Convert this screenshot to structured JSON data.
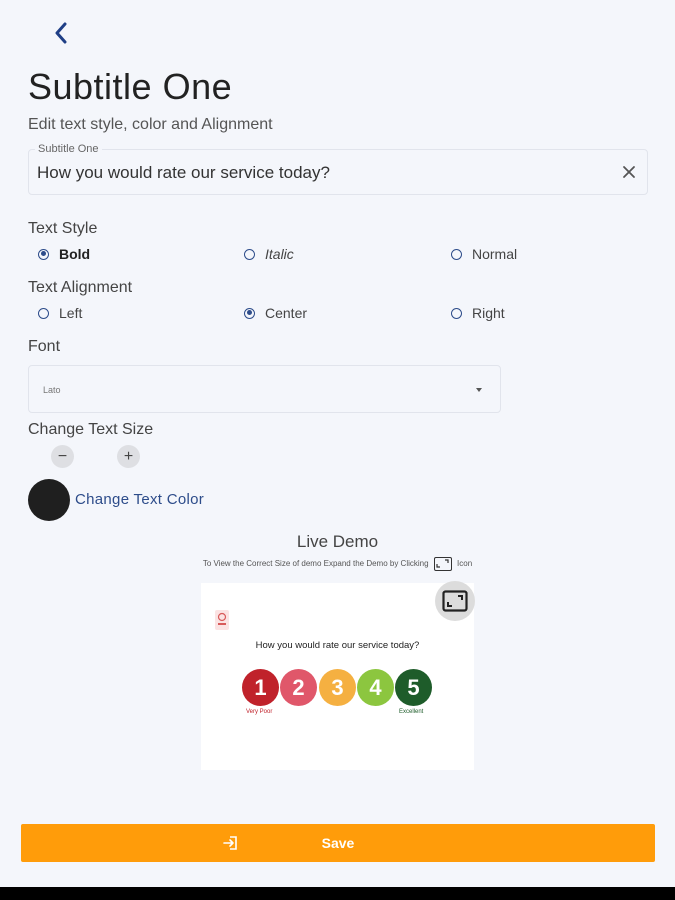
{
  "header": {
    "title": "Subtitle One",
    "description": "Edit text style, color and Alignment"
  },
  "subtitle_field": {
    "label": "Subtitle One",
    "value": "How you would rate our service today?"
  },
  "text_style": {
    "label": "Text Style",
    "options": [
      "Bold",
      "Italic",
      "Normal"
    ],
    "selected": "Bold"
  },
  "text_alignment": {
    "label": "Text Alignment",
    "options": [
      "Left",
      "Center",
      "Right"
    ],
    "selected": "Center"
  },
  "font": {
    "label": "Font",
    "value": "Lato"
  },
  "text_size": {
    "label": "Change Text Size",
    "decrease_symbol": "−",
    "increase_symbol": "+"
  },
  "text_color": {
    "link": "Change Text Color",
    "value": "#1f1f1f"
  },
  "live_demo": {
    "title": "Live Demo",
    "hint_before": "To View the Correct Size of demo Expand the Demo by Clicking",
    "hint_after": "Icon",
    "question": "How you would rate our service today?",
    "ratings": [
      {
        "label": "1",
        "color": "#c0222b"
      },
      {
        "label": "2",
        "color": "#e0576a"
      },
      {
        "label": "3",
        "color": "#f5b041"
      },
      {
        "label": "4",
        "color": "#8cc63f"
      },
      {
        "label": "5",
        "color": "#1e5c2a"
      }
    ],
    "low_caption": "Very Poor",
    "high_caption": "Excellent"
  },
  "footer": {
    "save_label": "Save",
    "accent": "#ff9c0a"
  }
}
